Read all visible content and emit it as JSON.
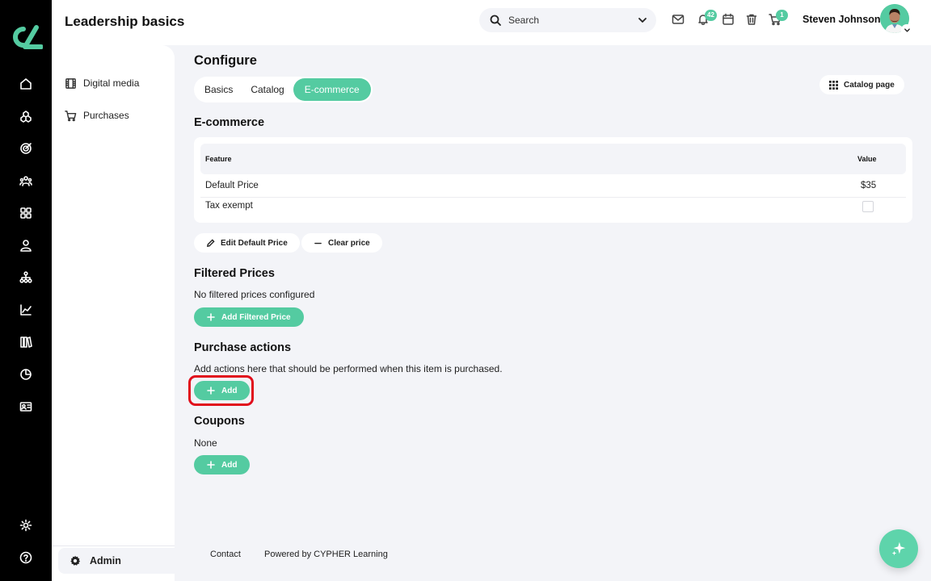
{
  "app": {
    "course_title": "Leadership basics",
    "accent_color": "#54cba1",
    "highlight_color": "#e10e1c"
  },
  "header": {
    "search_placeholder": "Search",
    "notifications_count": "42",
    "cart_count": "1",
    "user_name": "Steven Johnson"
  },
  "rail": {
    "icons": [
      "home-icon",
      "courses-icon",
      "target-icon",
      "groups-icon",
      "apps-icon",
      "user-icon",
      "hierarchy-icon",
      "analytics-icon",
      "library-icon",
      "pie-chart-icon",
      "id-card-icon",
      "settings-icon",
      "help-icon"
    ]
  },
  "sidebar": {
    "items": [
      {
        "label": "Digital media",
        "icon": "film-icon"
      },
      {
        "label": "Purchases",
        "icon": "cart-icon"
      }
    ],
    "admin_label": "Admin"
  },
  "main": {
    "title": "Configure",
    "tabs": [
      {
        "label": "Basics",
        "active": false
      },
      {
        "label": "Catalog",
        "active": false
      },
      {
        "label": "E-commerce",
        "active": true
      }
    ],
    "catalog_page_label": "Catalog page",
    "ecommerce": {
      "title": "E-commerce",
      "columns": [
        "Feature",
        "Value"
      ],
      "rows": [
        {
          "feature": "Default Price",
          "value": "$35"
        },
        {
          "feature": "Tax exempt",
          "value": ""
        }
      ],
      "edit_button": "Edit Default Price",
      "clear_button": "Clear price"
    },
    "filtered_prices": {
      "title": "Filtered Prices",
      "empty_text": "No filtered prices configured",
      "add_button": "Add Filtered Price"
    },
    "purchase_actions": {
      "title": "Purchase actions",
      "description": "Add actions here that should be performed when this item is purchased.",
      "add_button": "Add"
    },
    "coupons": {
      "title": "Coupons",
      "empty_text": "None",
      "add_button": "Add"
    }
  },
  "footer": {
    "contact": "Contact",
    "powered_by": "Powered by CYPHER Learning"
  }
}
